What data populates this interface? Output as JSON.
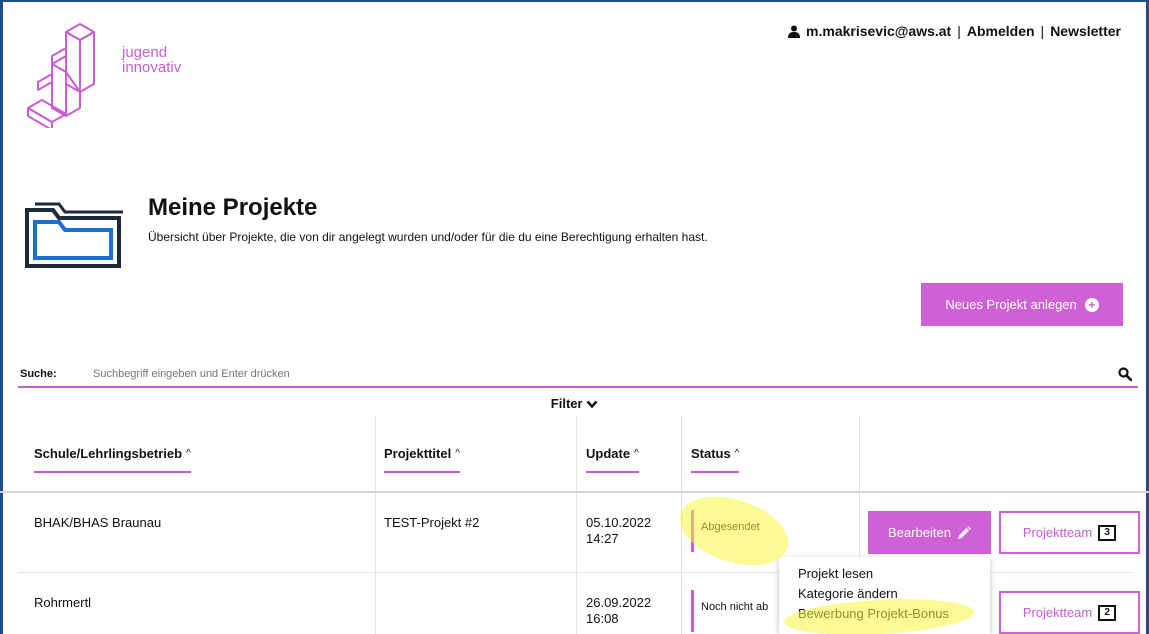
{
  "logo": {
    "line1": "jugend",
    "line2": "innovativ",
    "accent": "#c85ed0"
  },
  "topnav": {
    "user": "m.makrisevic@aws.at",
    "separator": "|",
    "logout": "Abmelden",
    "newsletter": "Newsletter"
  },
  "page": {
    "title": "Meine Projekte",
    "subtitle": "Übersicht über Projekte, die von dir angelegt wurden und/oder für die du eine Berechtigung erhalten hast."
  },
  "actions": {
    "new_project": "Neues Projekt anlegen"
  },
  "search": {
    "label": "Suche:",
    "placeholder": "Suchbegriff eingeben und Enter drücken"
  },
  "filter": {
    "label": "Filter"
  },
  "table": {
    "headers": [
      "Schule/Lehrlingsbetrieb",
      "Projekttitel",
      "Update",
      "Status"
    ],
    "sort_icon": "^",
    "rows": [
      {
        "school": "BHAK/BHAS Braunau",
        "title": "TEST-Projekt #2",
        "date": "05.10.2022",
        "time": "14:27",
        "status": "Abgesendet",
        "edit": "Bearbeiten",
        "team": "Projektteam",
        "team_count": "3"
      },
      {
        "school": "Rohrmertl",
        "title": "",
        "date": "26.09.2022",
        "time": "16:08",
        "status": "Noch nicht ab",
        "team": "Projektteam",
        "team_count": "2"
      }
    ]
  },
  "dropdown": {
    "items": [
      "Projekt lesen",
      "Kategorie ändern",
      "Bewerbung Projekt-Bonus"
    ]
  },
  "colors": {
    "accent": "#d060d6",
    "frame": "#1f4f8a",
    "folder": "#1d6fd8",
    "highlight": "#f8f23c"
  }
}
